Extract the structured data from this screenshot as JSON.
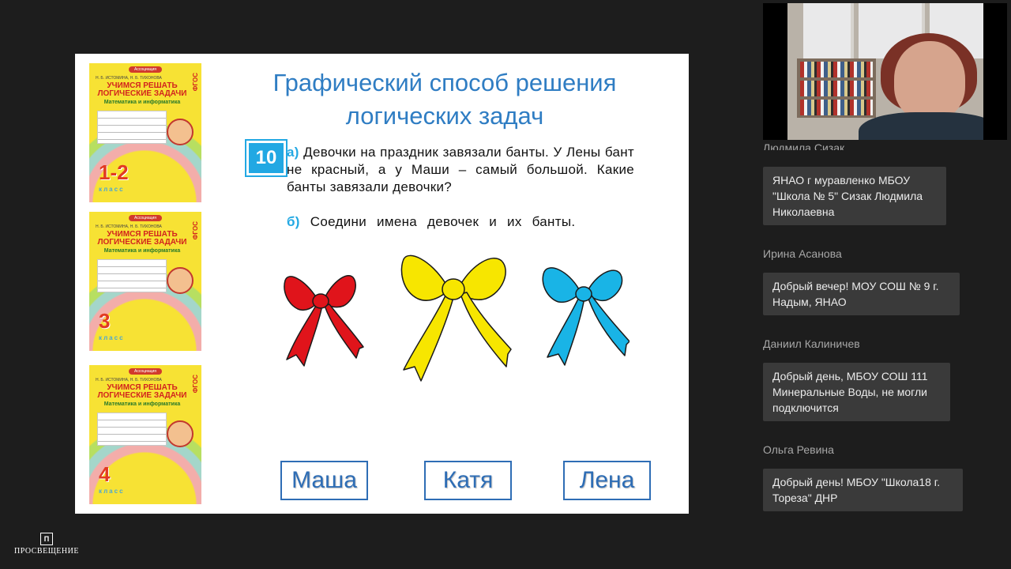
{
  "slide": {
    "title_line1": "Графический способ решения",
    "title_line2": "логических задач",
    "task_number": "10",
    "part_a_marker": "а)",
    "part_a_text": "Девочки на праздник завязали банты. У Лены бант не красный, а у Маши – самый большой. Какие банты завязали девочки?",
    "part_b_marker": "б)",
    "part_b_text": "Соедини имена девочек и их банты.",
    "bows": [
      {
        "name": "red-bow",
        "color": "#e0141b"
      },
      {
        "name": "yellow-bow",
        "color": "#f7e600"
      },
      {
        "name": "blue-bow",
        "color": "#19b4e6"
      }
    ],
    "names": [
      "Маша",
      "Катя",
      "Лена"
    ],
    "books": [
      {
        "grade": "1-2",
        "title": "УЧИМСЯ РЕШАТЬ ЛОГИЧЕСКИЕ ЗАДАЧИ",
        "subtitle": "Математика и информатика",
        "authors": "Н. Б. ИСТОМИНА, Н. Б. ТИХОНОВА",
        "fgos": "ФГОС",
        "klass": "класс",
        "publisher": "Ассоциация"
      },
      {
        "grade": "3",
        "title": "УЧИМСЯ РЕШАТЬ ЛОГИЧЕСКИЕ ЗАДАЧИ",
        "subtitle": "Математика и информатика",
        "authors": "Н. Б. ИСТОМИНА, Н. Б. ТИХОНОВА",
        "fgos": "ФГОС",
        "klass": "класс",
        "publisher": "Ассоциация"
      },
      {
        "grade": "4",
        "title": "УЧИМСЯ РЕШАТЬ ЛОГИЧЕСКИЕ ЗАДАЧИ",
        "subtitle": "Математика и информатика",
        "authors": "Н. Б. ИСТОМИНА, Н. Б. ТИХОНОВА",
        "fgos": "ФГОС",
        "klass": "класс",
        "publisher": "Ассоциация"
      }
    ]
  },
  "logo": {
    "text": "ПРОСВЕЩЕНИЕ",
    "mark": "П"
  },
  "chat": {
    "video_caption": "Людмила Сизак",
    "messages": [
      {
        "author": "",
        "text": "ЯНАО г муравленко МБОУ \"Школа № 5\" Сизак Людмила Николаевна"
      },
      {
        "author": "Ирина Асанова",
        "text": "Добрый вечер! МОУ СОШ № 9 г. Надым, ЯНАО"
      },
      {
        "author": "Даниил Калиничев",
        "text": "Добрый день, МБОУ СОШ 111 Минеральные Воды, не могли подключится"
      },
      {
        "author": "Ольга Ревина",
        "text": "Добрый день! МБОУ \"Школа18 г. Тореза\" ДНР"
      }
    ]
  },
  "colors": {
    "background": "#1d1d1d",
    "title": "#2f7dc3",
    "accent": "#22a8e3",
    "name_box": "#2e6db5",
    "bubble": "#3a3a3a"
  }
}
